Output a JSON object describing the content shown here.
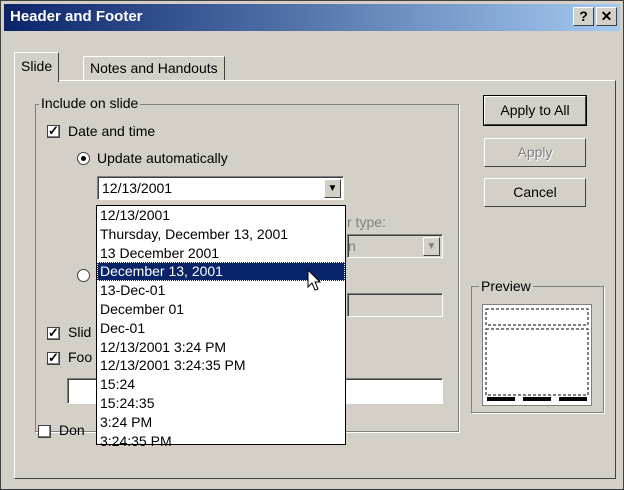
{
  "window": {
    "title": "Header and Footer",
    "help_glyph": "?",
    "close_glyph": "✕"
  },
  "tabs": [
    {
      "label": "Slide"
    },
    {
      "label": "Notes and Handouts"
    }
  ],
  "include": {
    "legend": "Include on slide",
    "date_time": "Date and time",
    "update_auto": "Update automatically",
    "date_value": "12/13/2001",
    "calendar_type_partial": "r type:",
    "calendar_value_partial": "n",
    "slide_number_partial": "Slid",
    "footer_partial": "Foo",
    "dont_show_partial": "Don"
  },
  "buttons": {
    "apply_all": "Apply to All",
    "apply": "Apply",
    "cancel": "Cancel"
  },
  "preview": {
    "legend": "Preview"
  },
  "date_options": [
    "12/13/2001",
    "Thursday, December 13, 2001",
    "13 December 2001",
    "December 13, 2001",
    "13-Dec-01",
    "December 01",
    "Dec-01",
    "12/13/2001 3:24 PM",
    "12/13/2001 3:24:35 PM",
    "15:24",
    "15:24:35",
    "3:24 PM",
    "3:24:35 PM"
  ],
  "selected_option": "December 13, 2001",
  "colors": {
    "face": "#d4d0c8",
    "title_start": "#0a246a",
    "title_end": "#a6caf0",
    "highlight": "#0a246a"
  }
}
